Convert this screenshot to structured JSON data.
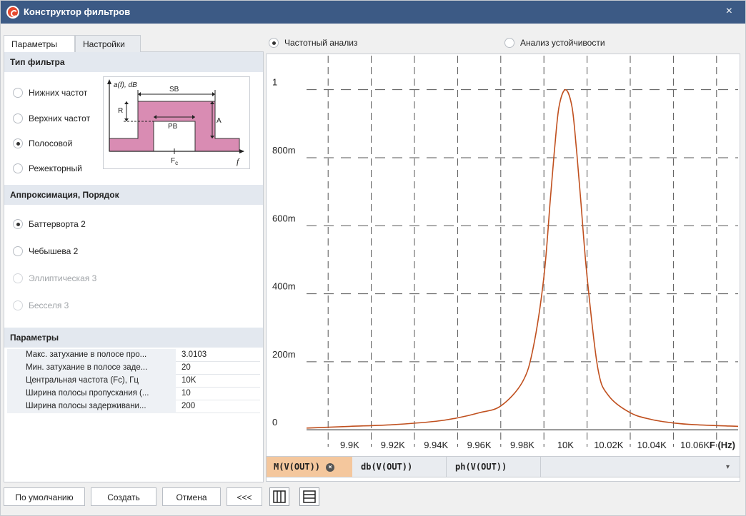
{
  "window": {
    "title": "Конструктор фильтров",
    "close_glyph": "×"
  },
  "tabs": [
    {
      "label": "Параметры",
      "active": true
    },
    {
      "label": "Настройки",
      "active": false
    }
  ],
  "filter_type": {
    "header": "Тип фильтра",
    "options": [
      {
        "label": "Нижних частот",
        "selected": false
      },
      {
        "label": "Верхних частот",
        "selected": false
      },
      {
        "label": "Полосовой",
        "selected": true
      },
      {
        "label": "Режекторный",
        "selected": false
      }
    ],
    "diagram": {
      "y_label": "a(f), dB",
      "sb": "SB",
      "pb": "PB",
      "r": "R",
      "a": "A",
      "fc": "F",
      "fc_sub": "c",
      "f": "f",
      "fill_color": "#d98cb3"
    }
  },
  "approximation": {
    "header": "Аппроксимация, Порядок",
    "options": [
      {
        "label": "Баттерворта 2",
        "selected": true,
        "disabled": false
      },
      {
        "label": "Чебышева 2",
        "selected": false,
        "disabled": false
      },
      {
        "label": "Эллиптическая 3",
        "selected": false,
        "disabled": true
      },
      {
        "label": "Бесселя 3",
        "selected": false,
        "disabled": true
      }
    ]
  },
  "params": {
    "header": "Параметры",
    "rows": [
      {
        "name": "Макс. затухание в полосе про...",
        "value": "3.0103"
      },
      {
        "name": "Мин. затухание в полосе заде...",
        "value": "20"
      },
      {
        "name": "Центральная частота (Fc), Гц",
        "value": "10K"
      },
      {
        "name": "Ширина полосы пропускания (...",
        "value": "10"
      },
      {
        "name": "Ширина полосы задерживани...",
        "value": "200"
      }
    ]
  },
  "buttons": {
    "default": "По умолчанию",
    "create": "Создать",
    "cancel": "Отмена",
    "collapse": "<<<"
  },
  "analysis_mode": [
    {
      "label": "Частотный анализ",
      "selected": true
    },
    {
      "label": "Анализ устойчивости",
      "selected": false
    }
  ],
  "traces": [
    {
      "label": "M(V(OUT))",
      "active": true
    },
    {
      "label": "db(V(OUT))",
      "active": false
    },
    {
      "label": "ph(V(OUT))",
      "active": false
    }
  ],
  "chart_data": {
    "type": "line",
    "title": "",
    "xlabel": "F (Hz)",
    "ylabel": "",
    "x_ticks": [
      "9.9K",
      "9.92K",
      "9.94K",
      "9.96K",
      "9.98K",
      "10K",
      "10.02K",
      "10.04K",
      "10.06K"
    ],
    "y_ticks": [
      "0",
      "200m",
      "400m",
      "600m",
      "800m",
      "1"
    ],
    "xlim": [
      9880,
      10080
    ],
    "ylim": [
      -0.05,
      1.1
    ],
    "series": [
      {
        "color": "#c0501f",
        "x": [
          9880,
          9900,
          9920,
          9940,
          9950,
          9960,
          9970,
          9980,
          9985,
          9990,
          9993,
          9995,
          9997,
          10000,
          10003,
          10005,
          10007,
          10010,
          10015,
          10020,
          10030,
          10040,
          10050,
          10060,
          10080
        ],
        "y": [
          0.005,
          0.01,
          0.015,
          0.025,
          0.035,
          0.05,
          0.07,
          0.14,
          0.24,
          0.45,
          0.68,
          0.83,
          0.95,
          1.0,
          0.95,
          0.83,
          0.68,
          0.45,
          0.18,
          0.1,
          0.05,
          0.03,
          0.02,
          0.015,
          0.01
        ]
      }
    ],
    "grid": true,
    "colors": {
      "curve": "#c0501f",
      "zero_line": "#333333",
      "grid": "#555555"
    }
  }
}
